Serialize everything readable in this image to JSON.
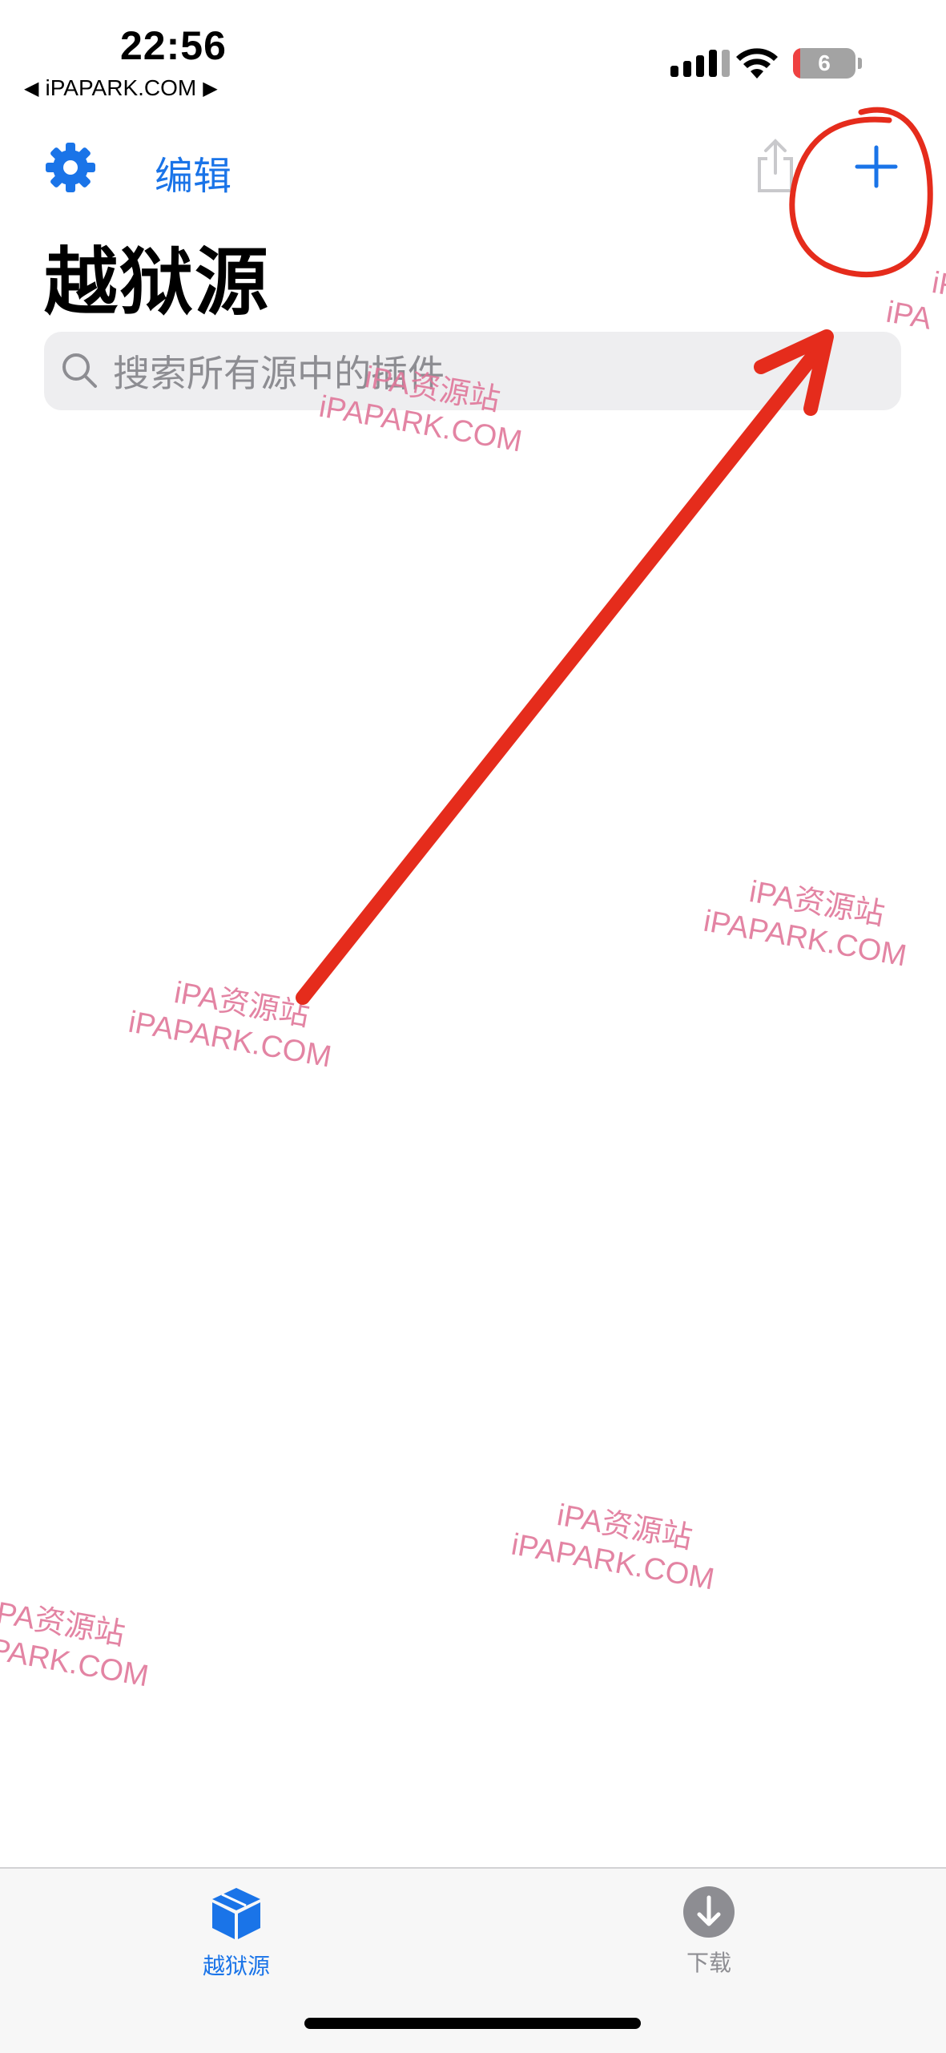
{
  "status_bar": {
    "time": "22:56",
    "back_app": "iPAPARK.COM",
    "back_arrow": "◀",
    "forward_arrow": "▶",
    "battery_level": "6"
  },
  "nav": {
    "edit_label": "编辑",
    "title": "越狱源",
    "search_placeholder": "搜索所有源中的插件"
  },
  "watermarks": [
    {
      "line1": "iPA资源站",
      "line2": "iPAPARK.COM"
    },
    {
      "line1": "iPA资源站",
      "line2": "iPAPARK.COM"
    },
    {
      "line1": "iPA资源站",
      "line2": "iPAPARK.COM"
    },
    {
      "line1": "iPA资源站",
      "line2": "iPAPARK.COM"
    },
    {
      "line1": "PA资源站",
      "line2": "PARK.COM"
    },
    {
      "line1": "iF",
      "line2": "iPA"
    }
  ],
  "tabbar": {
    "tabs": [
      {
        "label": "越狱源",
        "icon": "cube-icon",
        "active": true
      },
      {
        "label": "下载",
        "icon": "download-icon",
        "active": false
      }
    ]
  },
  "colors": {
    "accent": "#1a74e8",
    "annotation": "#e52c1c",
    "watermark": "#e0779a"
  }
}
